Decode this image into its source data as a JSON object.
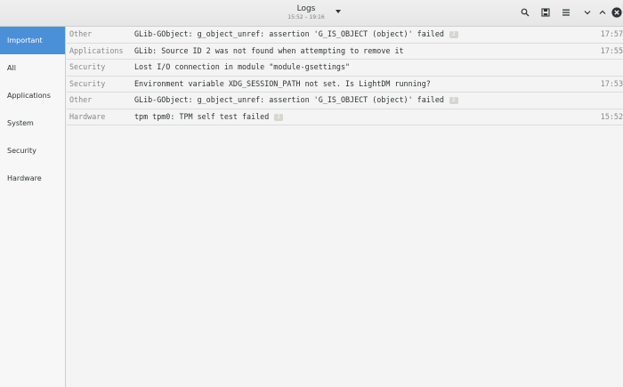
{
  "header": {
    "title": "Logs",
    "subtitle": "15:52 – 19:16"
  },
  "icons": {
    "range_menu": "chevron-down-icon",
    "search": "search-icon",
    "export": "save-icon",
    "menu": "hamburger-menu-icon",
    "minimize": "chevron-down-icon",
    "maximize": "chevron-up-icon",
    "close": "close-icon"
  },
  "sidebar": {
    "items": [
      {
        "label": "Important",
        "selected": true
      },
      {
        "label": "All",
        "selected": false
      },
      {
        "label": "Applications",
        "selected": false
      },
      {
        "label": "System",
        "selected": false
      },
      {
        "label": "Security",
        "selected": false
      },
      {
        "label": "Hardware",
        "selected": false
      }
    ]
  },
  "logs": [
    {
      "category": "Other",
      "message": "GLib-GObject: g_object_unref: assertion 'G_IS_OBJECT (object)' failed",
      "count": "2",
      "time": "17:57"
    },
    {
      "category": "Applications",
      "message": "GLib: Source ID 2 was not found when attempting to remove it",
      "count": "",
      "time": "17:55"
    },
    {
      "category": "Security",
      "message": "Lost I/O connection in module \"module-gsettings\"",
      "count": "",
      "time": ""
    },
    {
      "category": "Security",
      "message": "Environment variable XDG_SESSION_PATH not set. Is LightDM running?",
      "count": "",
      "time": "17:53"
    },
    {
      "category": "Other",
      "message": "GLib-GObject: g_object_unref: assertion 'G_IS_OBJECT (object)' failed",
      "count": "2",
      "time": ""
    },
    {
      "category": "Hardware",
      "message": "tpm tpm0: TPM self test failed",
      "count": "2",
      "time": "15:52"
    }
  ],
  "colors": {
    "accent": "#4a90d9",
    "category_text": "#888a85",
    "message_text": "#2e3436"
  }
}
